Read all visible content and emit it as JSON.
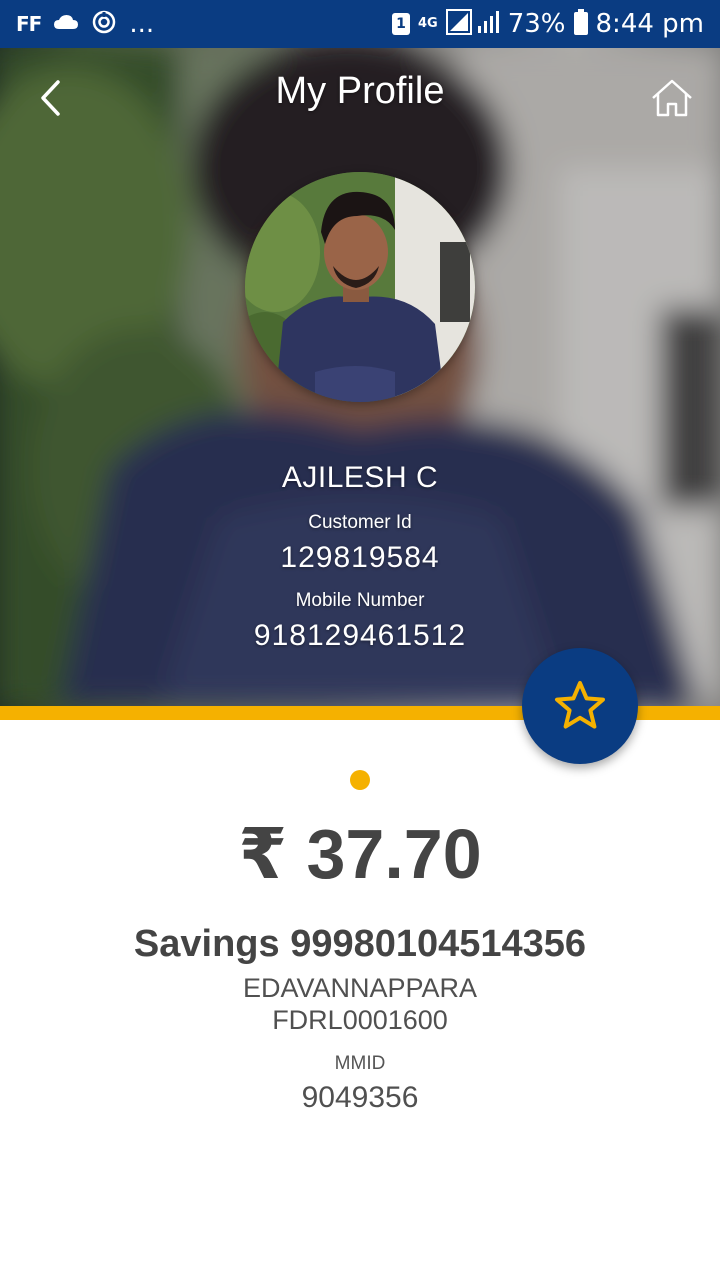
{
  "status_bar": {
    "left_text": "FF",
    "dots": "...",
    "sim_slot": "1",
    "network": "4G",
    "battery": "73%",
    "time": "8:44 pm"
  },
  "header": {
    "title": "My Profile",
    "back_icon": "chevron-left-icon",
    "home_icon": "home-icon"
  },
  "profile": {
    "name": "AJILESH C",
    "customer_id_label": "Customer Id",
    "customer_id": "129819584",
    "mobile_label": "Mobile Number",
    "mobile": "918129461512"
  },
  "favorite": {
    "icon": "star-icon"
  },
  "account": {
    "balance": "₹ 37.70",
    "title": "Savings 99980104514356",
    "branch": "EDAVANNAPPARA",
    "ifsc": "FDRL0001600",
    "mmid_label": "MMID",
    "mmid": "9049356"
  },
  "colors": {
    "primary": "#0a3c82",
    "accent": "#f5b100",
    "text": "#444444"
  }
}
